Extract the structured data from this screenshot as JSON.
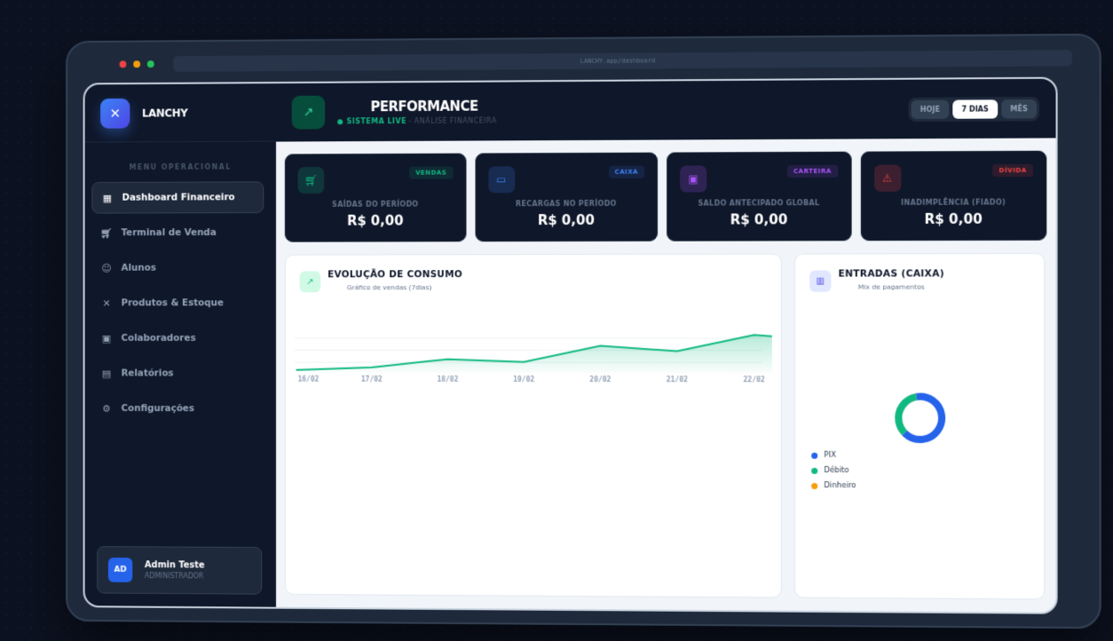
{
  "browser": {
    "url": "LANCHY.app/dashboard"
  },
  "brand": {
    "name": "LANCHY"
  },
  "sidebar": {
    "menu_title": "MENU OPERACIONAL",
    "items": [
      {
        "label": "Dashboard Financeiro",
        "icon": "grid-icon",
        "active": true
      },
      {
        "label": "Terminal de Venda",
        "icon": "cart-icon",
        "active": false
      },
      {
        "label": "Alunos",
        "icon": "users-icon",
        "active": false
      },
      {
        "label": "Produtos & Estoque",
        "icon": "utensils-icon",
        "active": false
      },
      {
        "label": "Colaboradores",
        "icon": "briefcase-icon",
        "active": false
      },
      {
        "label": "Relatórios",
        "icon": "file-icon",
        "active": false
      },
      {
        "label": "Configurações",
        "icon": "gear-icon",
        "active": false
      }
    ]
  },
  "user": {
    "initials": "AD",
    "name": "Admin Teste",
    "role": "ADMINISTRADOR"
  },
  "header": {
    "title": "PERFORMANCE",
    "live": "SISTEMA LIVE",
    "subtitle": "- ANÁLISE FINANCEIRA",
    "tabs": [
      {
        "label": "HOJE",
        "active": false
      },
      {
        "label": "7 DIAS",
        "active": true
      },
      {
        "label": "MÊS",
        "active": false
      }
    ]
  },
  "cards": [
    {
      "badge": "VENDAS",
      "label": "SAÍDAS DO PERÍODO",
      "value": "R$ 0,00",
      "color": "#10b981"
    },
    {
      "badge": "CAIXA",
      "label": "RECARGAS NO PERÍODO",
      "value": "R$ 0,00",
      "color": "#3b82f6"
    },
    {
      "badge": "CARTEIRA",
      "label": "SALDO ANTECIPADO GLOBAL",
      "value": "R$ 0,00",
      "color": "#a855f7"
    },
    {
      "badge": "DÍVIDA",
      "label": "INADIMPLÊNCIA (FIADO)",
      "value": "R$ 0,00",
      "color": "#ef4444"
    }
  ],
  "consumo": {
    "title": "EVOLUÇÃO DE CONSUMO",
    "subtitle": "Gráfico de vendas (7dias)"
  },
  "entradas": {
    "title": "ENTRADAS (CAIXA)",
    "subtitle": "Mix de pagamentos",
    "legend": [
      {
        "label": "PIX",
        "color": "#2563eb"
      },
      {
        "label": "Débito",
        "color": "#10b981"
      },
      {
        "label": "Dinheiro",
        "color": "#f59e0b"
      }
    ]
  },
  "chart_data": [
    {
      "type": "area",
      "categories": [
        "16/02",
        "17/02",
        "18/02",
        "19/02",
        "20/02",
        "21/02",
        "22/02"
      ],
      "values": [
        1,
        2,
        5,
        4,
        10,
        8,
        14,
        12
      ],
      "x_points": [
        0,
        1,
        2,
        3,
        4,
        5,
        6,
        6.9
      ],
      "ylim": [
        0,
        18
      ],
      "grid": true,
      "color": "#10b981"
    },
    {
      "type": "pie",
      "categories": [
        "PIX",
        "Débito",
        "Dinheiro"
      ],
      "values": [
        65,
        35,
        0
      ],
      "colors": [
        "#2563eb",
        "#10b981",
        "#f59e0b"
      ]
    }
  ]
}
